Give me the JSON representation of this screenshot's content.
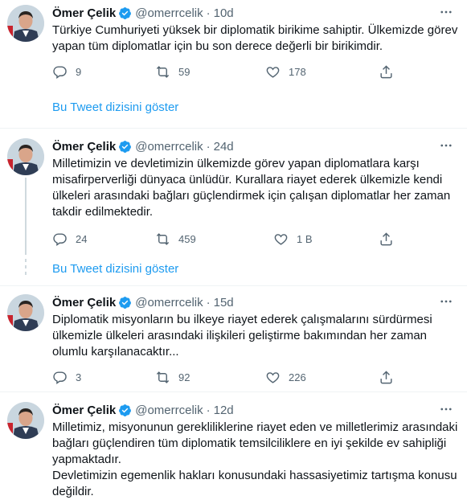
{
  "tweets": [
    {
      "name": "Ömer Çelik",
      "handle": "@omerrcelik",
      "separator": "·",
      "time": "10d",
      "lines": [
        "Türkiye Cumhuriyeti yüksek bir diplomatik birikime sahiptir. Ülkemizde görev",
        "yapan tüm diplomatlar için bu son derece değerli bir birikimdir."
      ],
      "replies": "9",
      "retweets": "59",
      "likes": "178",
      "thread_link": "Bu Tweet dizisini göster"
    },
    {
      "name": "Ömer Çelik",
      "handle": "@omerrcelik",
      "separator": "·",
      "time": "24d",
      "lines": [
        "Milletimizin ve devletimizin ülkemizde görev yapan diplomatlara karşı",
        "misafirperverliği dünyaca ünlüdür. Kurallara riayet ederek ülkemizle kendi",
        "ülkeleri arasındaki bağları güçlendirmek için çalışan diplomatlar her zaman",
        "takdir edilmektedir."
      ],
      "replies": "24",
      "retweets": "459",
      "likes": "1 B",
      "thread_link": "Bu Tweet dizisini göster"
    },
    {
      "name": "Ömer Çelik",
      "handle": "@omerrcelik",
      "separator": "·",
      "time": "15d",
      "lines": [
        "Diplomatik misyonların bu ilkeye riayet ederek çalışmalarını sürdürmesi",
        "ülkemizle ülkeleri arasındaki ilişkileri geliştirme bakımından her zaman",
        "olumlu karşılanacaktır..."
      ],
      "replies": "3",
      "retweets": "92",
      "likes": "226"
    },
    {
      "name": "Ömer Çelik",
      "handle": "@omerrcelik",
      "separator": "·",
      "time": "12d",
      "lines": [
        "Milletimiz, misyonunun gerekliliklerine riayet eden ve milletlerimiz arasındaki",
        "bağları güçlendiren tüm diplomatik temsilciliklere en iyi şekilde ev sahipliği",
        "yapmaktadır.",
        "Devletimizin egemenlik hakları konusundaki hassasiyetimiz tartışma konusu",
        "değildir."
      ]
    }
  ],
  "colors": {
    "accent": "#1d9bf0",
    "secondary_text": "#536471",
    "divider": "#eff3f4",
    "thread_line": "#cfd9de"
  },
  "icons": {
    "verified": "verified-badge-icon",
    "more": "more-icon",
    "reply": "reply-icon",
    "retweet": "retweet-icon",
    "like": "like-icon",
    "share": "share-icon"
  }
}
